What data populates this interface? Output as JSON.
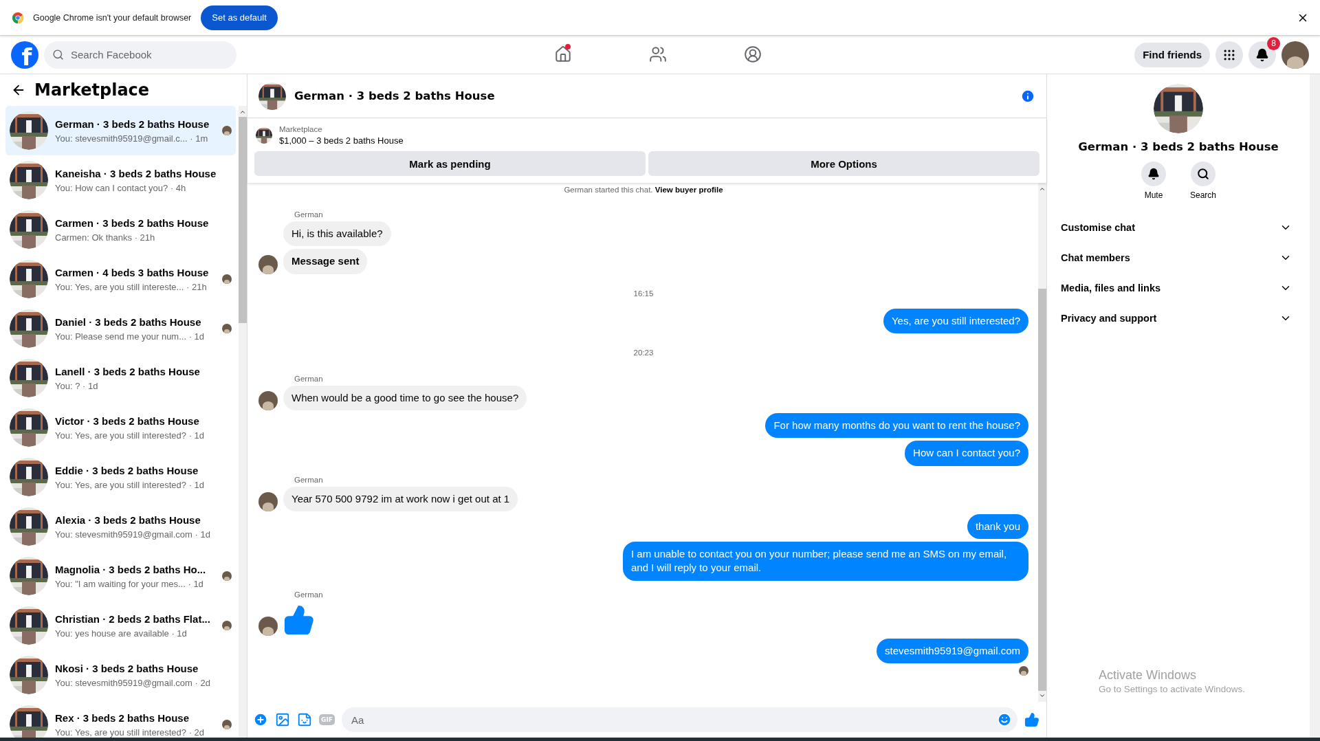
{
  "browser_infobar": {
    "message": "Google Chrome isn't your default browser",
    "button": "Set as default"
  },
  "topbar": {
    "logo_letter": "f",
    "search": {
      "placeholder": "Search Facebook"
    },
    "nav": [
      {
        "kind": "home",
        "selected": false,
        "dot": true
      },
      {
        "kind": "friends",
        "selected": false,
        "dot": false
      },
      {
        "kind": "groups",
        "selected": false,
        "dot": false
      }
    ],
    "find_friends": "Find friends",
    "notifications_badge": "8"
  },
  "sidebar": {
    "title": "Marketplace",
    "conversations": [
      {
        "title": "German · 3 beds 2 baths House",
        "preview": "You: stevesmith95919@gmail.c...",
        "time": "· 1m",
        "selected": true,
        "seen": true
      },
      {
        "title": "Kaneisha · 3 beds 2 baths House",
        "preview": "You: How can I contact you?",
        "time": "· 4h",
        "selected": false,
        "seen": false
      },
      {
        "title": "Carmen · 3 beds 2 baths House",
        "preview": "Carmen: Ok thanks",
        "time": "· 21h",
        "selected": false,
        "seen": false
      },
      {
        "title": "Carmen · 4 beds 3 baths House",
        "preview": "You: Yes, are you still intereste...",
        "time": "· 21h",
        "selected": false,
        "seen": true
      },
      {
        "title": "Daniel · 3 beds 2 baths House",
        "preview": "You: Please send me your num...",
        "time": "· 1d",
        "selected": false,
        "seen": true
      },
      {
        "title": "Lanell · 3 beds 2 baths House",
        "preview": "You: ?",
        "time": "· 1d",
        "selected": false,
        "seen": false
      },
      {
        "title": "Victor · 3 beds 2 baths House",
        "preview": "You: Yes, are you still interested?",
        "time": "· 1d",
        "selected": false,
        "seen": false
      },
      {
        "title": "Eddie · 3 beds 2 baths House",
        "preview": "You: Yes, are you still interested?",
        "time": "· 1d",
        "selected": false,
        "seen": false
      },
      {
        "title": "Alexia · 3 beds 2 baths House",
        "preview": "You: stevesmith95919@gmail.com",
        "time": "· 1d",
        "selected": false,
        "seen": false
      },
      {
        "title": "Magnolia · 3 beds 2 baths Ho...",
        "preview": "You: \"I am waiting for your mes...",
        "time": "· 1d",
        "selected": false,
        "seen": true
      },
      {
        "title": "Christian · 2 beds 2 baths Flat...",
        "preview": "You: yes house are available",
        "time": "· 1d",
        "selected": false,
        "seen": true
      },
      {
        "title": "Nkosi · 3 beds 2 baths House",
        "preview": "You: stevesmith95919@gmail.com",
        "time": "· 2d",
        "selected": false,
        "seen": false
      },
      {
        "title": "Rex · 3 beds 2 baths House",
        "preview": "You: Yes, are you still interested?",
        "time": "· 2d",
        "selected": false,
        "seen": true
      }
    ]
  },
  "chat": {
    "title": "German · 3 beds 2 baths House",
    "listing": {
      "source": "Marketplace",
      "price_title": "$1,000 – 3 beds 2 baths House",
      "buttons": [
        "Mark as pending",
        "More Options"
      ]
    },
    "notice": {
      "text": "German started this chat.",
      "link": "View buyer profile"
    },
    "messages": [
      {
        "kind": "sender",
        "text": "German"
      },
      {
        "kind": "received",
        "text": "Hi, is this available?",
        "avatar": false,
        "bold": false
      },
      {
        "kind": "received",
        "text": "Message sent",
        "avatar": true,
        "bold": true
      },
      {
        "kind": "time",
        "text": "16:15"
      },
      {
        "kind": "sent",
        "text": "Yes, are you still interested?"
      },
      {
        "kind": "time",
        "text": "20:23"
      },
      {
        "kind": "sender",
        "text": "German"
      },
      {
        "kind": "received",
        "text": "When would be a good time to go see the house?",
        "avatar": true,
        "bold": false
      },
      {
        "kind": "sent",
        "text": "For how many months do you want to rent the house?"
      },
      {
        "kind": "sent",
        "text": "How can I contact you?"
      },
      {
        "kind": "sender",
        "text": "German"
      },
      {
        "kind": "received",
        "text": "Year 570 500 9792 im at work now i get out at 1",
        "avatar": true,
        "bold": false
      },
      {
        "kind": "sent",
        "text": "thank you"
      },
      {
        "kind": "sent",
        "text": "I am unable to contact you on your number; please send me an SMS on my email, and I will reply to your email."
      },
      {
        "kind": "sender",
        "text": "German"
      },
      {
        "kind": "like"
      },
      {
        "kind": "sent",
        "text": "stevesmith95919@gmail.com"
      },
      {
        "kind": "seen"
      }
    ],
    "composer": {
      "gif_label": "GIF",
      "placeholder": "Aa"
    }
  },
  "details": {
    "title": "German · 3 beds 2 baths House",
    "actions": [
      {
        "kind": "mute",
        "label": "Mute"
      },
      {
        "kind": "search",
        "label": "Search"
      }
    ],
    "sections": [
      {
        "label": "Customise chat",
        "expanded": false
      },
      {
        "label": "Chat members",
        "expanded": false
      },
      {
        "label": "Media, files and links",
        "expanded": false
      },
      {
        "label": "Privacy and support",
        "expanded": false
      }
    ]
  },
  "os_notice": {
    "title": "Activate Windows",
    "text": "Go to Settings to activate Windows."
  }
}
